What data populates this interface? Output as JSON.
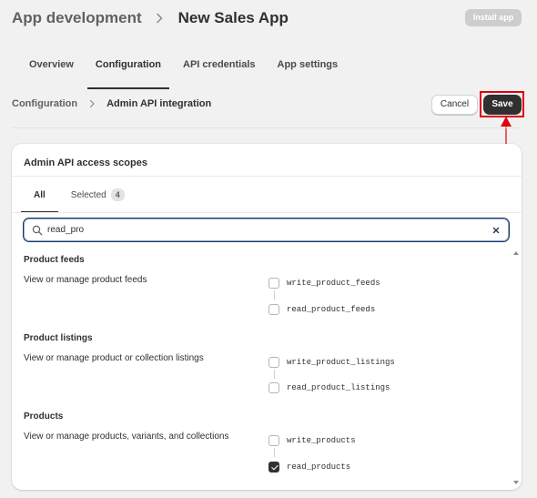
{
  "header": {
    "app_crumb": "App development",
    "title": "New Sales App",
    "install_label": "Install app"
  },
  "tabs": [
    {
      "label": "Overview",
      "active": false
    },
    {
      "label": "Configuration",
      "active": true
    },
    {
      "label": "API credentials",
      "active": false
    },
    {
      "label": "App settings",
      "active": false
    }
  ],
  "subheader": {
    "crumb": "Configuration",
    "title": "Admin API integration",
    "cancel_label": "Cancel",
    "save_label": "Save"
  },
  "card": {
    "title": "Admin API access scopes",
    "tabs": [
      {
        "label": "All",
        "active": true
      },
      {
        "label": "Selected",
        "count": "4",
        "active": false
      }
    ],
    "search": {
      "value": "read_pro",
      "placeholder": ""
    },
    "sections": [
      {
        "title": "Product feeds",
        "description": "View or manage product feeds",
        "scopes": [
          {
            "label": "write_product_feeds",
            "checked": false
          },
          {
            "label": "read_product_feeds",
            "checked": false
          }
        ]
      },
      {
        "title": "Product listings",
        "description": "View or manage product or collection listings",
        "scopes": [
          {
            "label": "write_product_listings",
            "checked": false
          },
          {
            "label": "read_product_listings",
            "checked": false
          }
        ]
      },
      {
        "title": "Products",
        "description": "View or manage products, variants, and collections",
        "scopes": [
          {
            "label": "write_products",
            "checked": false
          },
          {
            "label": "read_products",
            "checked": true
          }
        ]
      }
    ]
  },
  "colors": {
    "background": "#f1f1f1",
    "primary_button": "#303030",
    "highlight": "#e0000b",
    "focus_border": "#1c3659"
  },
  "icons": {
    "breadcrumb_separator": "chevron-right-icon",
    "search": "search-icon",
    "clear": "x-icon",
    "checked": "checkmark-icon"
  }
}
